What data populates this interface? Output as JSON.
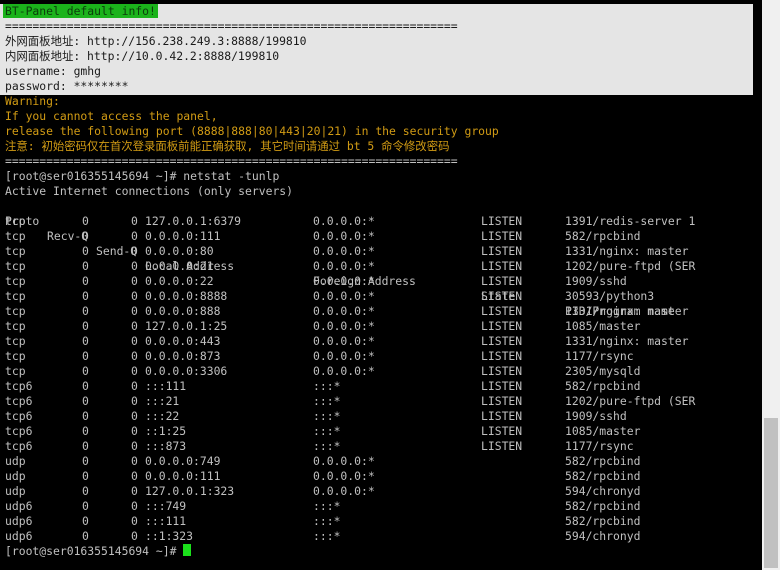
{
  "panel_info": {
    "header": "BT-Panel default info!",
    "separator": "==================================================================",
    "outer_url": "外网面板地址: http://156.238.249.3:8888/199810",
    "inner_url": "内网面板地址: http://10.0.42.2:8888/199810",
    "username": "username: gmhg",
    "password": "password: ********"
  },
  "warning": {
    "title": "Warning:",
    "line1": "If you cannot access the panel,",
    "line2": "release the following port (8888|888|80|443|20|21) in the security group",
    "line3": "注意: 初始密码仅在首次登录面板前能正确获取, 其它时间请通过 bt 5 命令修改密码"
  },
  "separator2": "==================================================================",
  "prompt_command": "[root@ser016355145694 ~]# netstat -tunlp",
  "active_header": "Active Internet connections (only servers)",
  "columns": [
    "Proto",
    "Recv-Q",
    "Send-Q",
    "Local Address",
    "Foreign Address",
    "State",
    "PID/Program name"
  ],
  "rows": [
    [
      "tcp",
      "0",
      "0",
      "127.0.0.1:6379",
      "0.0.0.0:*",
      "LISTEN",
      "1391/redis-server 1"
    ],
    [
      "tcp",
      "0",
      "0",
      "0.0.0.0:111",
      "0.0.0.0:*",
      "LISTEN",
      "582/rpcbind"
    ],
    [
      "tcp",
      "0",
      "0",
      "0.0.0.0:80",
      "0.0.0.0:*",
      "LISTEN",
      "1331/nginx: master"
    ],
    [
      "tcp",
      "0",
      "0",
      "0.0.0.0:21",
      "0.0.0.0:*",
      "LISTEN",
      "1202/pure-ftpd (SER"
    ],
    [
      "tcp",
      "0",
      "0",
      "0.0.0.0:22",
      "0.0.0.0:*",
      "LISTEN",
      "1909/sshd"
    ],
    [
      "tcp",
      "0",
      "0",
      "0.0.0.0:8888",
      "0.0.0.0:*",
      "LISTEN",
      "30593/python3"
    ],
    [
      "tcp",
      "0",
      "0",
      "0.0.0.0:888",
      "0.0.0.0:*",
      "LISTEN",
      "1331/nginx: master"
    ],
    [
      "tcp",
      "0",
      "0",
      "127.0.0.1:25",
      "0.0.0.0:*",
      "LISTEN",
      "1085/master"
    ],
    [
      "tcp",
      "0",
      "0",
      "0.0.0.0:443",
      "0.0.0.0:*",
      "LISTEN",
      "1331/nginx: master"
    ],
    [
      "tcp",
      "0",
      "0",
      "0.0.0.0:873",
      "0.0.0.0:*",
      "LISTEN",
      "1177/rsync"
    ],
    [
      "tcp",
      "0",
      "0",
      "0.0.0.0:3306",
      "0.0.0.0:*",
      "LISTEN",
      "2305/mysqld"
    ],
    [
      "tcp6",
      "0",
      "0",
      ":::111",
      ":::*",
      "LISTEN",
      "582/rpcbind"
    ],
    [
      "tcp6",
      "0",
      "0",
      ":::21",
      ":::*",
      "LISTEN",
      "1202/pure-ftpd (SER"
    ],
    [
      "tcp6",
      "0",
      "0",
      ":::22",
      ":::*",
      "LISTEN",
      "1909/sshd"
    ],
    [
      "tcp6",
      "0",
      "0",
      "::1:25",
      ":::*",
      "LISTEN",
      "1085/master"
    ],
    [
      "tcp6",
      "0",
      "0",
      ":::873",
      ":::*",
      "LISTEN",
      "1177/rsync"
    ],
    [
      "udp",
      "0",
      "0",
      "0.0.0.0:749",
      "0.0.0.0:*",
      "",
      "582/rpcbind"
    ],
    [
      "udp",
      "0",
      "0",
      "0.0.0.0:111",
      "0.0.0.0:*",
      "",
      "582/rpcbind"
    ],
    [
      "udp",
      "0",
      "0",
      "127.0.0.1:323",
      "0.0.0.0:*",
      "",
      "594/chronyd"
    ],
    [
      "udp6",
      "0",
      "0",
      ":::749",
      ":::*",
      "",
      "582/rpcbind"
    ],
    [
      "udp6",
      "0",
      "0",
      ":::111",
      ":::*",
      "",
      "582/rpcbind"
    ],
    [
      "udp6",
      "0",
      "0",
      "::1:323",
      ":::*",
      "",
      "594/chronyd"
    ]
  ],
  "final_prompt": "[root@ser016355145694 ~]# ",
  "colors": {
    "background": "#000000",
    "text": "#c0c0c0",
    "highlight_band": "#e5e5e5",
    "header_green": "#1bb31b",
    "warning": "#d19b14",
    "cursor": "#1be01b"
  },
  "icons": {
    "cursor": "block-cursor-icon"
  }
}
